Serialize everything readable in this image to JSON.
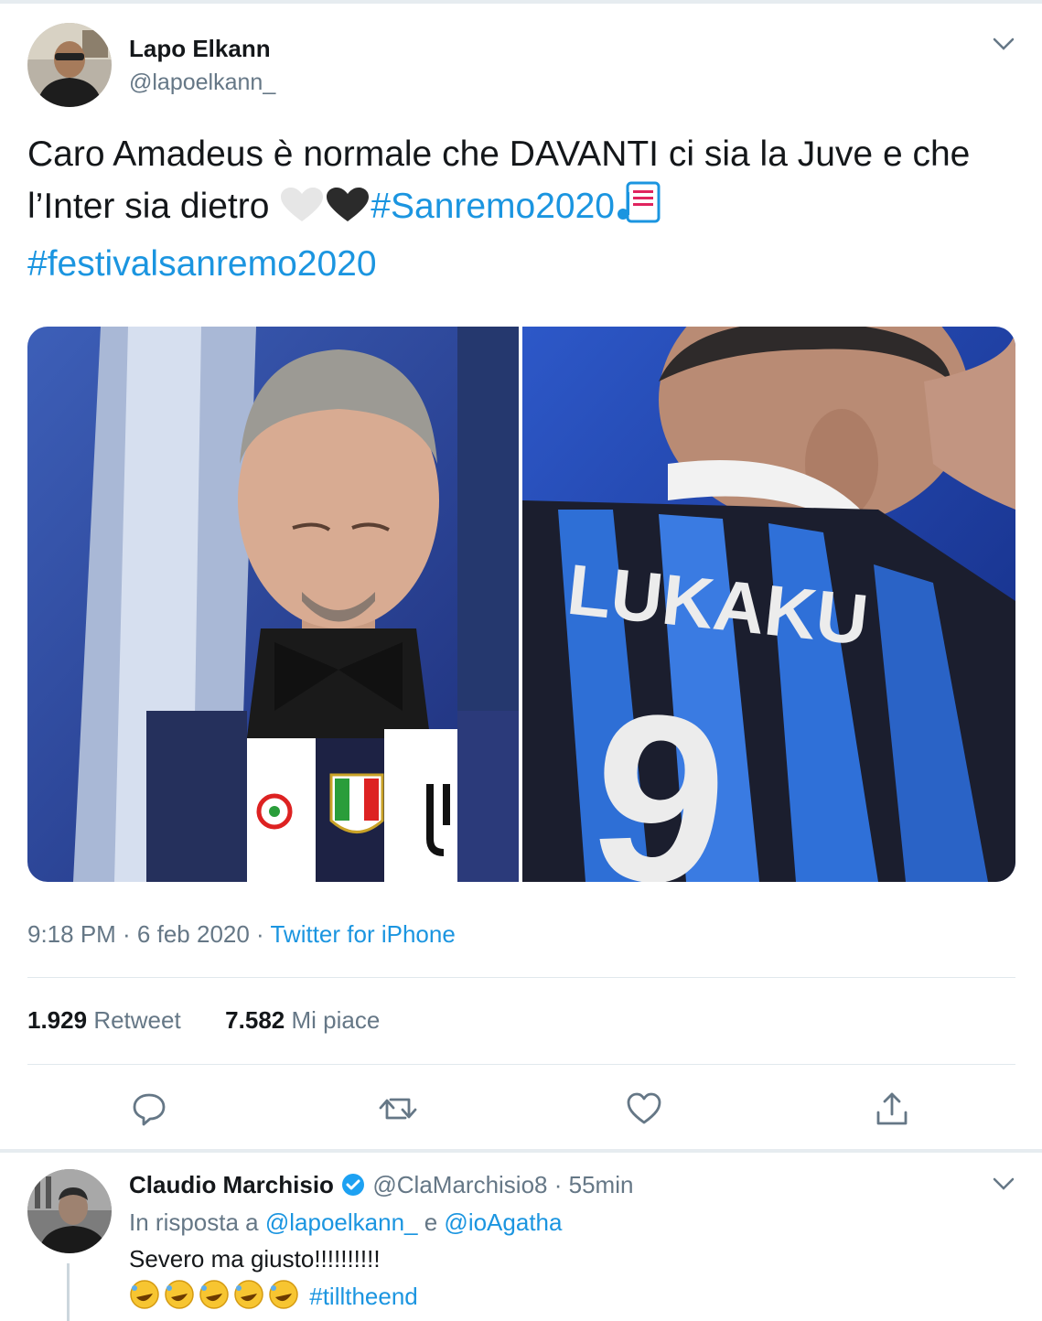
{
  "tweet": {
    "author_name": "Lapo Elkann",
    "author_handle": "@lapoelkann_",
    "text_part1": "Caro Amadeus è normale che DAVANTI ci sia la Juve e che l’Inter sia dietro ",
    "hashtag1": "#Sanremo2020",
    "hashtag2": "#festivalsanremo2020",
    "media_jersey_text": "LUKAKU",
    "media_jersey_number": "9",
    "time": "9:18 PM · 6 feb 2020 · ",
    "source": "Twitter for iPhone",
    "retweet_count": "1.929",
    "retweet_label": "Retweet",
    "like_count": "7.582",
    "like_label": "Mi piace"
  },
  "reply": {
    "author_name": "Claudio Marchisio",
    "author_handle": "@ClaMarchisio8",
    "time": "· 55min",
    "in_reply_prefix": "In risposta a ",
    "mention1": "@lapoelkann_",
    "mention_joiner": " e ",
    "mention2": "@ioAgatha",
    "text": "Severo ma giusto!!!!!!!!!!",
    "hashtag": "#tilltheend"
  },
  "colors": {
    "link": "#1b95e0",
    "muted": "#657786",
    "text": "#14171a",
    "verified": "#1da1f2"
  },
  "icons": [
    "chevron-down-icon",
    "reply-icon",
    "retweet-icon",
    "like-icon",
    "share-icon",
    "verified-icon"
  ]
}
